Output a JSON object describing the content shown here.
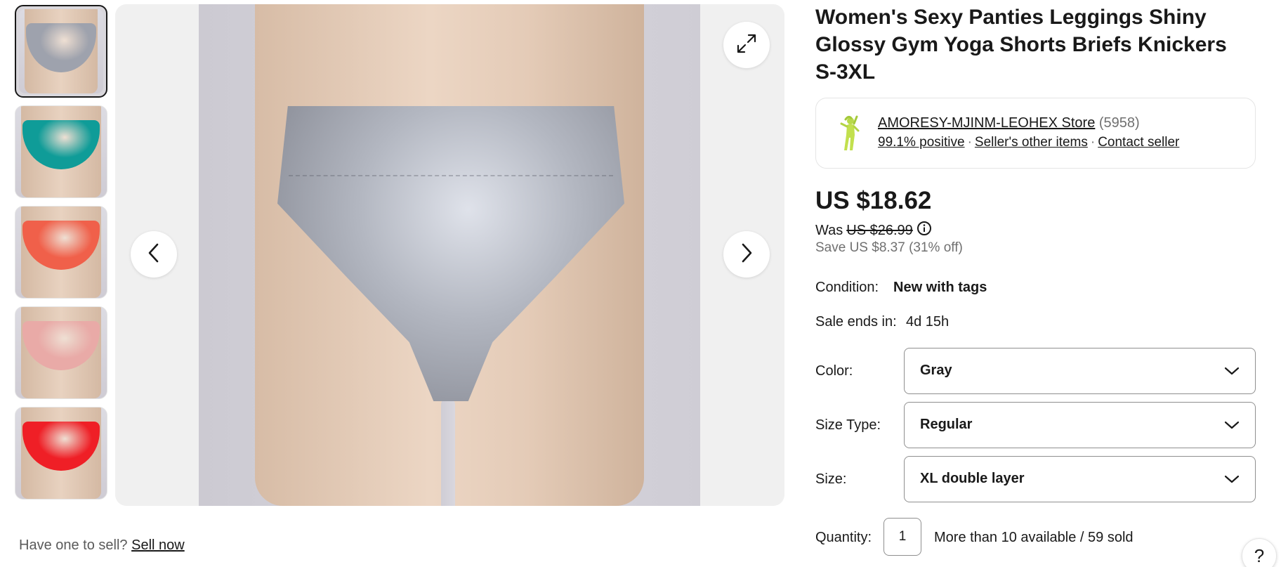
{
  "gallery": {
    "thumbnails": [
      {
        "color_name": "gray",
        "color": "#9ea2ad",
        "selected": true
      },
      {
        "color_name": "teal",
        "color": "#0f9c98",
        "selected": false
      },
      {
        "color_name": "coral",
        "color": "#f0604a",
        "selected": false
      },
      {
        "color_name": "pink",
        "color": "#e9aaa7",
        "selected": false
      },
      {
        "color_name": "red",
        "color": "#ef1f26",
        "selected": false
      }
    ],
    "icons": {
      "prev": "chevron-left-icon",
      "next": "chevron-right-icon",
      "expand": "expand-icon"
    }
  },
  "sell": {
    "prompt": "Have one to sell?",
    "link": "Sell now"
  },
  "listing": {
    "title": "Women's Sexy Panties Leggings Shiny Glossy Gym Yoga Shorts Briefs Knickers S-3XL",
    "seller": {
      "name": "AMORESY-MJINM-LEOHEX Store",
      "count": "(5958)",
      "positive": "99.1% positive",
      "other_items": "Seller's other items",
      "contact": "Contact seller",
      "separator": "·"
    },
    "price": "US $18.62",
    "was_label": "Was",
    "was_price": "US $26.99",
    "save": "Save US $8.37 (31% off)",
    "condition_label": "Condition:",
    "condition_value": "New with tags",
    "sale_label": "Sale ends in:",
    "sale_value": "4d 15h",
    "color_label": "Color:",
    "color_value": "Gray",
    "size_type_label": "Size Type:",
    "size_type_value": "Regular",
    "size_label": "Size:",
    "size_value": "XL double layer",
    "quantity_label": "Quantity:",
    "quantity_value": "1",
    "availability": "More than 10 available / 59 sold"
  },
  "help": {
    "label": "?"
  }
}
